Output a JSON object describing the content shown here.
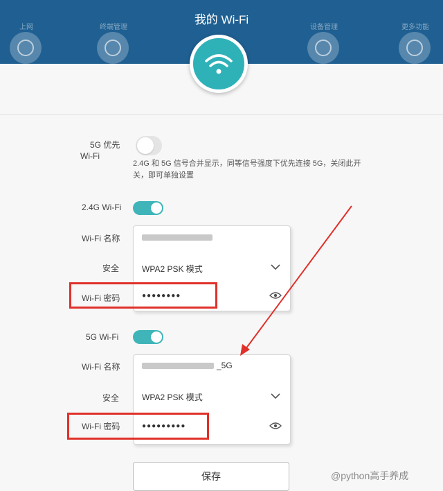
{
  "header": {
    "title": "我的 Wi-Fi",
    "nav": [
      {
        "label": "上网"
      },
      {
        "label": "终端管理"
      },
      {
        "label": "设备管理"
      },
      {
        "label": "更多功能"
      }
    ]
  },
  "band_steering": {
    "label_line1": "5G 优先",
    "label_line2": "Wi-Fi",
    "description": "2.4G 和 5G 信号合并显示，同等信号强度下优先连接 5G，关闭此开关，即可单独设置"
  },
  "wifi24": {
    "label": "2.4G Wi-Fi",
    "enabled": true,
    "name_label": "Wi-Fi 名称",
    "security_label": "安全",
    "security_value": "WPA2 PSK 模式",
    "password_label": "Wi-Fi 密码",
    "password_value": "●●●●●●●●"
  },
  "wifi5": {
    "label": "5G Wi-Fi",
    "enabled": true,
    "name_label": "Wi-Fi 名称",
    "name_suffix": "_5G",
    "security_label": "安全",
    "security_value": "WPA2 PSK 模式",
    "password_label": "Wi-Fi 密码",
    "password_value": "●●●●●●●●●"
  },
  "save_label": "保存",
  "watermark": "@python高手养成",
  "colors": {
    "header": "#1f5f91",
    "accent": "#3fb5b9",
    "highlight": "#e03029"
  }
}
